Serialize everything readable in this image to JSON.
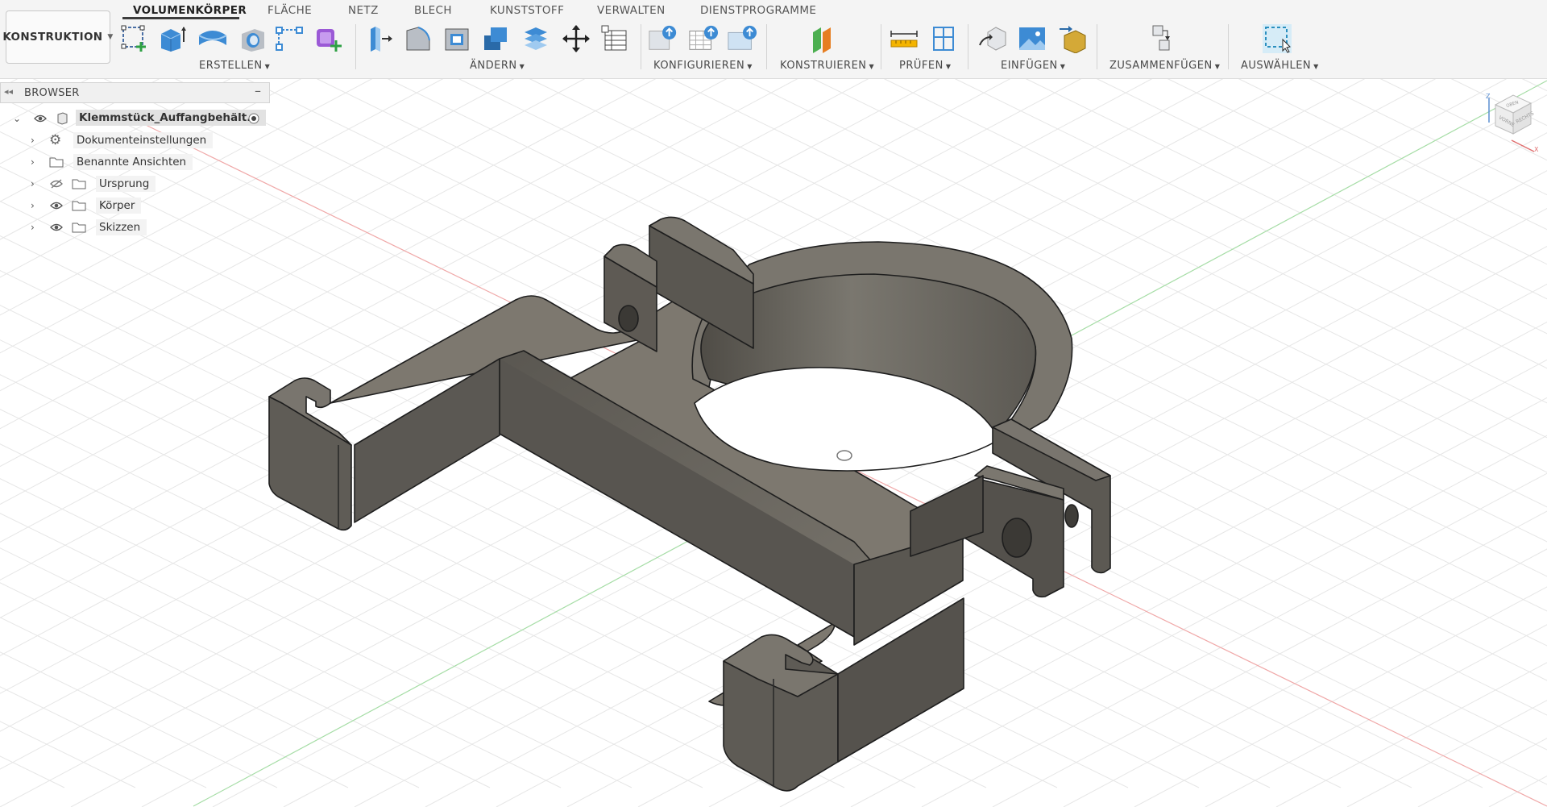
{
  "workspace": {
    "label": "KONSTRUKTION"
  },
  "tabs": [
    "VOLUMENKÖRPER",
    "FLÄCHE",
    "NETZ",
    "BLECH",
    "KUNSTSTOFF",
    "VERWALTEN",
    "DIENSTPROGRAMME"
  ],
  "active_tab": "VOLUMENKÖRPER",
  "groups": {
    "erstellen": "ERSTELLEN",
    "aendern": "ÄNDERN",
    "konfigurieren": "KONFIGURIEREN",
    "konstruieren": "KONSTRUIEREN",
    "pruefen": "PRÜFEN",
    "einfuegen": "EINFÜGEN",
    "zusammenfuegen": "ZUSAMMENFÜGEN",
    "auswaehlen": "AUSWÄHLEN"
  },
  "browser": {
    "title": "BROWSER",
    "root": "Klemmstück_Auffangbehält...",
    "items": [
      "Dokumenteinstellungen",
      "Benannte Ansichten",
      "Ursprung",
      "Körper",
      "Skizzen"
    ]
  },
  "viewcube": {
    "top": "OBEN",
    "front": "VORNE",
    "right": "RECHTS"
  },
  "colors": {
    "toolbar_bg": "#f4f4f4",
    "body_fill": "#6e6a63",
    "x_axis": "#e8a0a0",
    "y_axis": "#9fd89f",
    "z_axis": "#7aa7d8"
  }
}
